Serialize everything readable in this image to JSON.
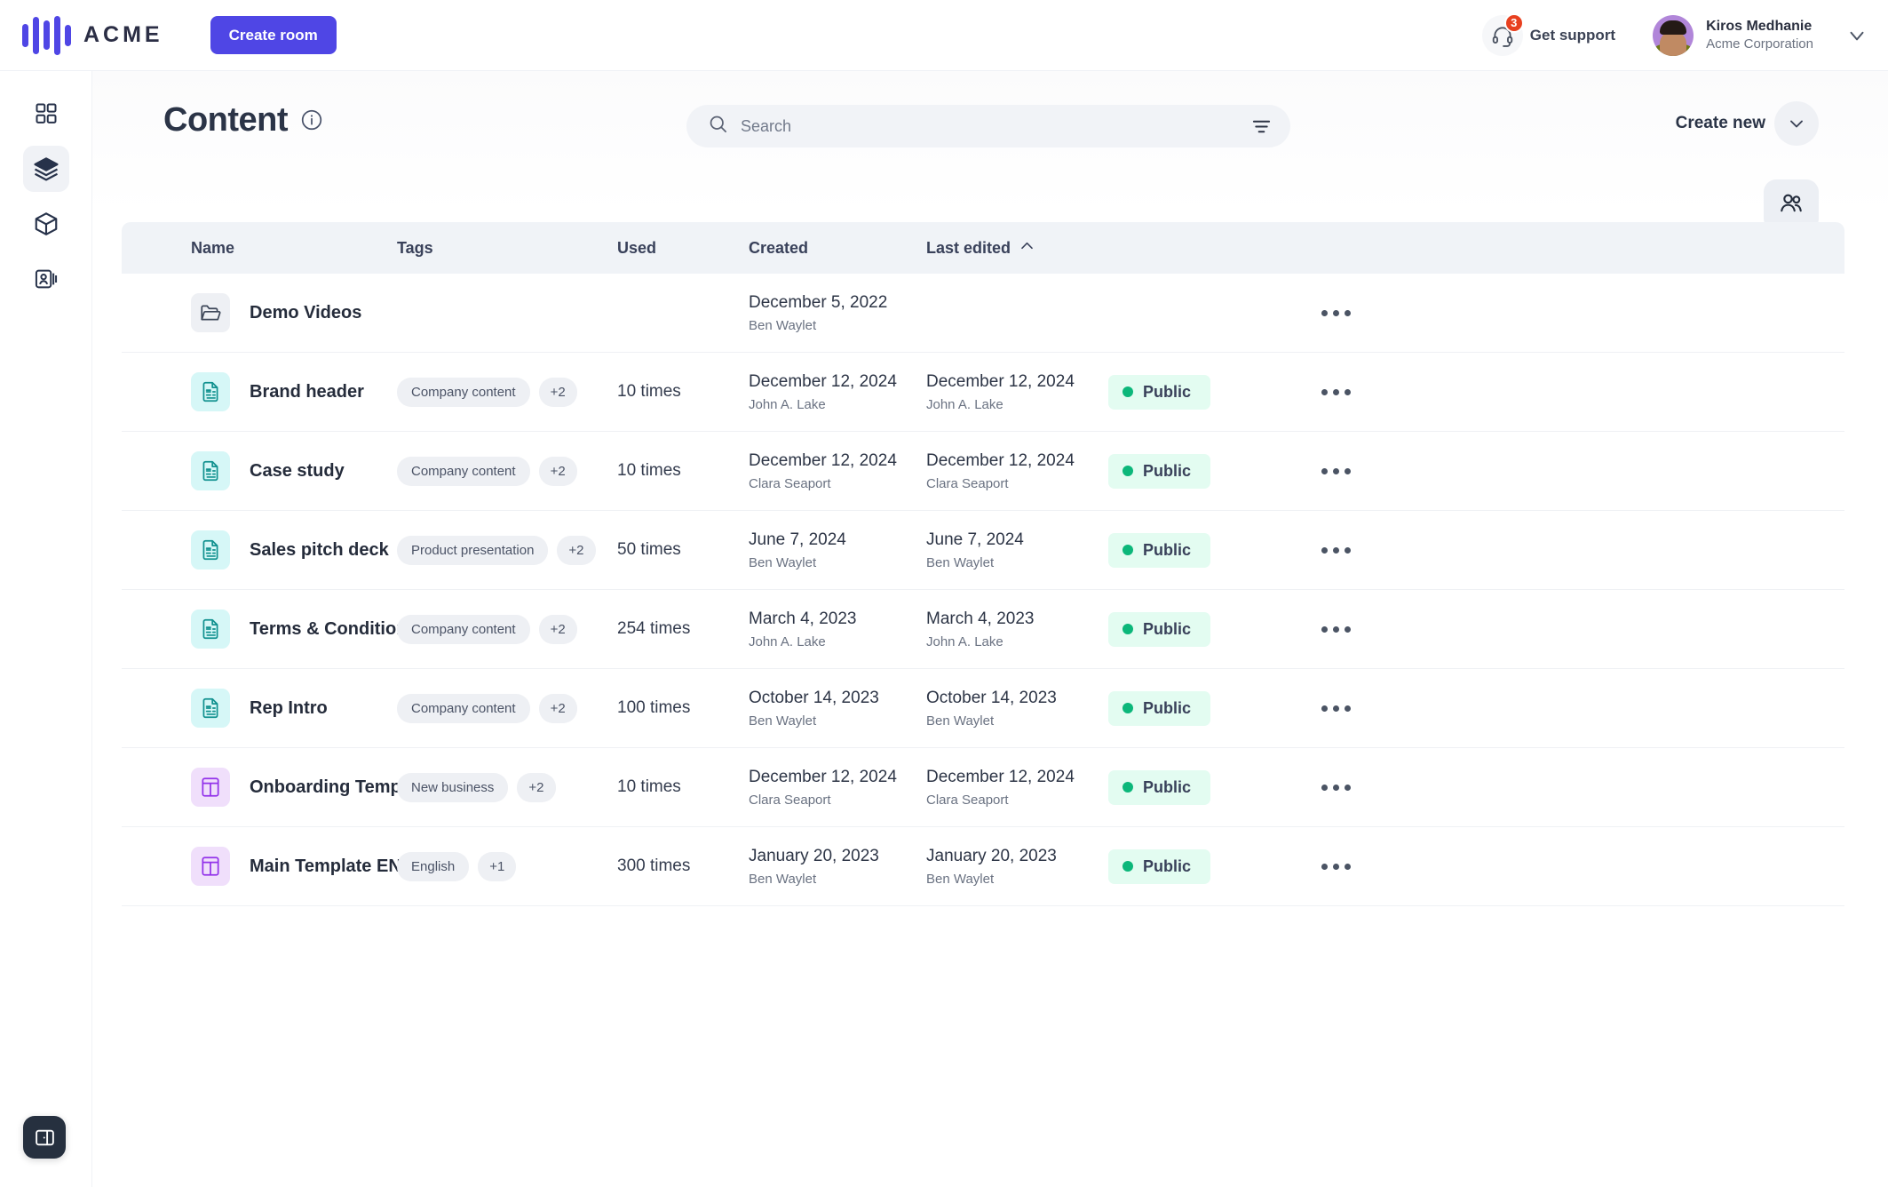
{
  "brand": {
    "name": "ACME",
    "logo_icon": "acme-waveform-logo",
    "accent": "#4f46e5"
  },
  "topbar": {
    "create_room_label": "Create room",
    "support": {
      "label": "Get support",
      "icon": "headset-icon",
      "badge_count": "3",
      "badge_color": "#e8401f"
    },
    "user": {
      "name": "Kiros Medhanie",
      "org": "Acme Corporation",
      "avatar_icon": "avatar",
      "chevron_icon": "chevron-down-icon"
    }
  },
  "sidebar": {
    "items": [
      {
        "icon": "grid-dashboard-icon",
        "active": false
      },
      {
        "icon": "layers-icon",
        "active": true
      },
      {
        "icon": "cube-icon",
        "active": false
      },
      {
        "icon": "contact-card-icon",
        "active": false
      }
    ],
    "panel_toggle_icon": "sidebar-panel-toggle-icon"
  },
  "page": {
    "title": "Content",
    "info_icon": "info-icon"
  },
  "search": {
    "placeholder": "Search",
    "value": "",
    "search_icon": "search-icon",
    "filter_icon": "filter-icon"
  },
  "actions": {
    "create_new_label": "Create new",
    "create_new_icon": "chevron-down-icon",
    "people_icon": "people-icon"
  },
  "table": {
    "columns": [
      "Name",
      "Tags",
      "Used",
      "Created",
      "Last edited"
    ],
    "sort": {
      "column": "Last edited",
      "direction": "asc",
      "icon": "chevron-up-icon"
    },
    "rows": [
      {
        "icon": "folder-icon",
        "icon_kind": "folder",
        "name": "Demo Videos",
        "tags": [],
        "tag_more": "",
        "used": "",
        "created_date": "December 5, 2022",
        "created_by": "Ben Waylet",
        "edited_date": "",
        "edited_by": "",
        "status": "",
        "more_icon": "more-horizontal-icon"
      },
      {
        "icon": "document-icon",
        "icon_kind": "doc",
        "name": "Brand header",
        "tags": [
          "Company content"
        ],
        "tag_more": "+2",
        "used": "10 times",
        "created_date": "December 12, 2024",
        "created_by": "John A. Lake",
        "edited_date": "December 12, 2024",
        "edited_by": "John A. Lake",
        "status": "Public",
        "more_icon": "more-horizontal-icon"
      },
      {
        "icon": "document-icon",
        "icon_kind": "doc",
        "name": "Case study",
        "tags": [
          "Company content"
        ],
        "tag_more": "+2",
        "used": "10 times",
        "created_date": "December 12, 2024",
        "created_by": "Clara Seaport",
        "edited_date": "December 12, 2024",
        "edited_by": "Clara Seaport",
        "status": "Public",
        "more_icon": "more-horizontal-icon"
      },
      {
        "icon": "document-icon",
        "icon_kind": "doc",
        "name": "Sales pitch deck",
        "tags": [
          "Product presentation"
        ],
        "tag_more": "+2",
        "used": "50 times",
        "created_date": "June 7, 2024",
        "created_by": "Ben Waylet",
        "edited_date": "June 7, 2024",
        "edited_by": "Ben Waylet",
        "status": "Public",
        "more_icon": "more-horizontal-icon"
      },
      {
        "icon": "document-icon",
        "icon_kind": "doc",
        "name": "Terms & Conditions",
        "tags": [
          "Company content"
        ],
        "tag_more": "+2",
        "used": "254 times",
        "created_date": "March 4, 2023",
        "created_by": "John A. Lake",
        "edited_date": "March 4, 2023",
        "edited_by": "John A. Lake",
        "status": "Public",
        "more_icon": "more-horizontal-icon"
      },
      {
        "icon": "document-icon",
        "icon_kind": "doc",
        "name": "Rep Intro",
        "tags": [
          "Company content"
        ],
        "tag_more": "+2",
        "used": "100 times",
        "created_date": "October 14, 2023",
        "created_by": "Ben Waylet",
        "edited_date": "October 14, 2023",
        "edited_by": "Ben Waylet",
        "status": "Public",
        "more_icon": "more-horizontal-icon"
      },
      {
        "icon": "template-icon",
        "icon_kind": "tpl",
        "name": "Onboarding Template ENG",
        "tags": [
          "New business"
        ],
        "tag_more": "+2",
        "used": "10 times",
        "created_date": "December 12, 2024",
        "created_by": "Clara Seaport",
        "edited_date": "December 12, 2024",
        "edited_by": "Clara Seaport",
        "status": "Public",
        "more_icon": "more-horizontal-icon"
      },
      {
        "icon": "template-icon",
        "icon_kind": "tpl",
        "name": "Main Template ENG",
        "tags": [
          "English"
        ],
        "tag_more": "+1",
        "used": "300 times",
        "created_date": "January 20, 2023",
        "created_by": "Ben Waylet",
        "edited_date": "January 20, 2023",
        "edited_by": "Ben Waylet",
        "status": "Public",
        "more_icon": "more-horizontal-icon"
      }
    ],
    "status_colors": {
      "public_bg": "#e3fcf1",
      "public_dot": "#0cb77a"
    }
  }
}
